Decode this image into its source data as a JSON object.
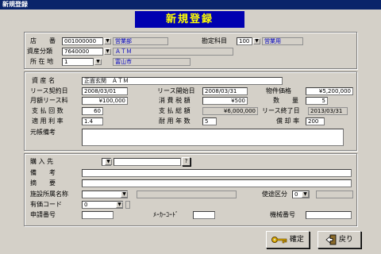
{
  "window": {
    "title": "新規登録"
  },
  "header": {
    "title": "新規登録"
  },
  "top": {
    "store_label": "店　　番",
    "store_value": "001000000",
    "store_name": "営業部",
    "account_label": "勘定科目",
    "account_value": "100",
    "account_name": "営業用",
    "asset_class_label": "資産分類",
    "asset_class_value": "7640000",
    "asset_class_name": "ＡＴＭ",
    "location_label": "所 在 地",
    "location_value": "1",
    "location_name": "富山市"
  },
  "middle": {
    "asset_name_label": "資 産 名",
    "asset_name_value": "正面玄関　ＡＴＭ",
    "lease_contract_label": "リース契約日",
    "lease_contract_value": "2008/03/01",
    "lease_start_label": "リース開始日",
    "lease_start_value": "2008/03/31",
    "property_price_label": "物件価格",
    "property_price_value": "¥5,200,000",
    "monthly_fee_label": "月額リース料",
    "monthly_fee_value": "¥100,000",
    "tax_label": "消 費 税 額",
    "tax_value": "¥500",
    "quantity_label": "数　　量",
    "quantity_value": "5",
    "payments_label": "支 払 回 数",
    "payments_value": "60",
    "total_label": "支 払 総 額",
    "total_value": "¥6,000,000",
    "lease_end_label": "リース終了日",
    "lease_end_value": "2013/03/31",
    "rate_label": "適 用 利 率",
    "rate_value": "1.4",
    "life_label": "耐 用 年 数",
    "life_value": "5",
    "depr_label": "償 却 率",
    "depr_value": "200",
    "note_label": "元帳備考",
    "note_value": ""
  },
  "bottom": {
    "purchase_label": "購 入 先",
    "purchase_btn": "?",
    "remark_label": "備　　考",
    "summary_label": "摘　　要",
    "facility_label": "施設所属名称",
    "usage_label": "使途区分",
    "usage_value": "0",
    "valuable_label": "有価コード",
    "valuable_value": "0",
    "apply_label": "申請番号",
    "maker_label": "ﾒｰｶｰｺｰﾄﾞ",
    "model_label": "機械番号"
  },
  "footer": {
    "confirm_label": "確定",
    "back_label": "戻り"
  }
}
